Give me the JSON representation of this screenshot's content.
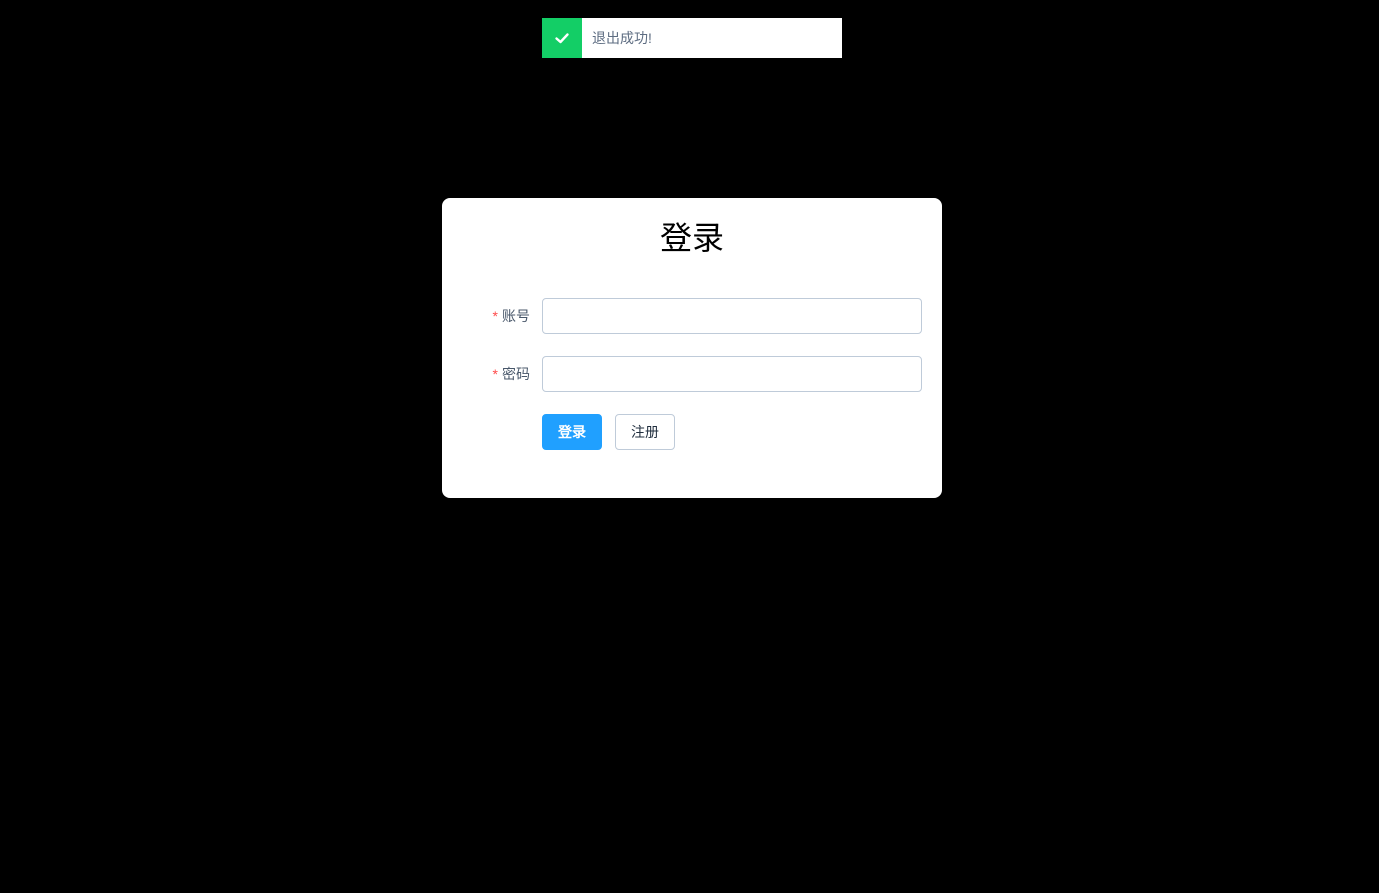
{
  "toast": {
    "icon": "check-icon",
    "message": "退出成功!",
    "color": "#13ce66"
  },
  "login": {
    "title": "登录",
    "fields": [
      {
        "label": "账号",
        "required_mark": "*",
        "value": "",
        "placeholder": ""
      },
      {
        "label": "密码",
        "required_mark": "*",
        "value": "",
        "placeholder": ""
      }
    ],
    "login_button": "登录",
    "register_button": "注册",
    "primary_color": "#20a0ff"
  }
}
